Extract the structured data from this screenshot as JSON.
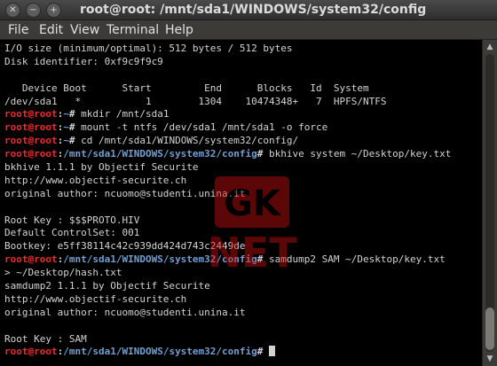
{
  "window": {
    "title": "root@root: /mnt/sda1/WINDOWS/system32/config",
    "buttons": {
      "close": "✕",
      "minimize": "−",
      "maximize": "+"
    }
  },
  "menu": {
    "items": [
      "File",
      "Edit",
      "View",
      "Terminal",
      "Help"
    ]
  },
  "prompt": {
    "user": "root@root",
    "sep": ":",
    "sym": "#"
  },
  "terminal": {
    "lines": [
      {
        "type": "out",
        "text": "I/O size (minimum/optimal): 512 bytes / 512 bytes"
      },
      {
        "type": "out",
        "text": "Disk identifier: 0xf9c9f9c9"
      },
      {
        "type": "out",
        "text": ""
      },
      {
        "type": "out",
        "text": "   Device Boot      Start         End      Blocks   Id  System"
      },
      {
        "type": "out",
        "text": "/dev/sda1   *           1        1304    10474348+   7  HPFS/NTFS"
      },
      {
        "type": "cmd",
        "path": "~",
        "cmd": " mkdir /mnt/sda1"
      },
      {
        "type": "cmd",
        "path": "~",
        "cmd": " mount -t ntfs /dev/sda1 /mnt/sda1 -o force"
      },
      {
        "type": "cmd",
        "path": "~",
        "cmd": " cd /mnt/sda1/WINDOWS/system32/config/"
      },
      {
        "type": "cmd",
        "path": "/mnt/sda1/WINDOWS/system32/config",
        "cmd": " bkhive system ~/Desktop/key.txt"
      },
      {
        "type": "out",
        "text": "bkhive 1.1.1 by Objectif Securite"
      },
      {
        "type": "out",
        "text": "http://www.objectif-securite.ch"
      },
      {
        "type": "out",
        "text": "original author: ncuomo@studenti.unina.it"
      },
      {
        "type": "out",
        "text": ""
      },
      {
        "type": "out",
        "text": "Root Key : $$$PROTO.HIV"
      },
      {
        "type": "out",
        "text": "Default ControlSet: 001"
      },
      {
        "type": "out",
        "text": "Bootkey: e5ff38114c42c939dd424d743c2449de"
      },
      {
        "type": "cmd",
        "path": "/mnt/sda1/WINDOWS/system32/config",
        "cmd": " samdump2 SAM ~/Desktop/key.txt"
      },
      {
        "type": "out",
        "text": "> ~/Desktop/hash.txt"
      },
      {
        "type": "out",
        "text": "samdump2 1.1.1 by Objectif Securite"
      },
      {
        "type": "out",
        "text": "http://www.objectif-securite.ch"
      },
      {
        "type": "out",
        "text": "original author: ncuomo@studenti.unina.it"
      },
      {
        "type": "out",
        "text": ""
      },
      {
        "type": "out",
        "text": "Root Key : SAM"
      },
      {
        "type": "cmd",
        "path": "/mnt/sda1/WINDOWS/system32/config",
        "cmd": " ",
        "cursor": true
      }
    ]
  },
  "colors": {
    "user": "#ef2929",
    "path": "#729fcf",
    "text": "#d3d3d3",
    "background": "#000000",
    "watermark": "#cc1111"
  },
  "watermark": {
    "top": "GK",
    "bottom": "NET"
  },
  "scrollbar": {
    "up_icon": "▲",
    "down_icon": "▼",
    "thumb_position_pct": 100
  }
}
